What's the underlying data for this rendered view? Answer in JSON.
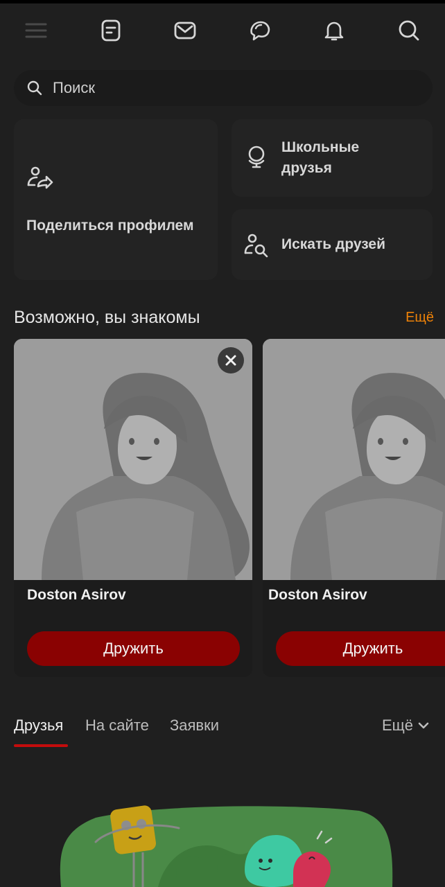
{
  "topbar": {
    "icons": [
      "menu-icon",
      "feed-icon",
      "mail-icon",
      "chat-icon",
      "bell-icon",
      "search-icon"
    ]
  },
  "search": {
    "placeholder": "Поиск"
  },
  "quick_actions": {
    "share_profile": "Поделиться профилем",
    "school_friends": "Школьные друзья",
    "find_friends": "Искать друзей"
  },
  "suggestions": {
    "title": "Возможно, вы знакомы",
    "more": "Ещё",
    "cards": [
      {
        "name": "Doston Asirov",
        "button": "Дружить"
      },
      {
        "name": "Doston Asirov",
        "button": "Дружить"
      }
    ]
  },
  "tabs": {
    "items": [
      "Друзья",
      "На сайте",
      "Заявки"
    ],
    "active": "Друзья",
    "more": "Ещё"
  },
  "colors": {
    "accent_orange": "#ee8208",
    "button_red": "#8a0202",
    "tab_underline": "#c40c0c",
    "background": "#1f1f1f"
  }
}
